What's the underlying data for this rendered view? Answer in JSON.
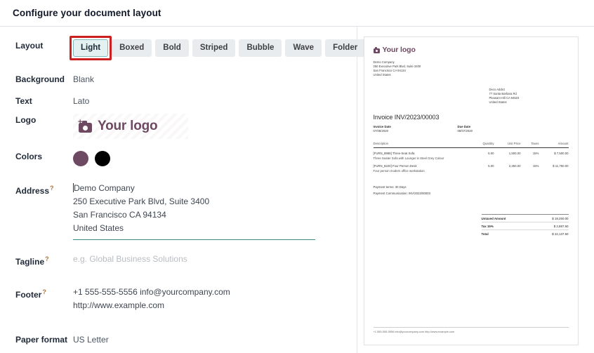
{
  "dialog": {
    "title": "Configure your document layout"
  },
  "form": {
    "layout": {
      "label": "Layout",
      "options": [
        "Light",
        "Boxed",
        "Bold",
        "Striped",
        "Bubble",
        "Wave",
        "Folder"
      ],
      "selected": "Light",
      "highlight_color": "#cc1f1f"
    },
    "background": {
      "label": "Background",
      "value": "Blank"
    },
    "text": {
      "label": "Text",
      "value": "Lato"
    },
    "logo": {
      "label": "Logo",
      "value": "Your logo",
      "icon": "camera-icon",
      "color": "#6d4a62"
    },
    "colors": {
      "label": "Colors",
      "swatches": [
        "#6d4a62",
        "#000000"
      ]
    },
    "address": {
      "label": "Address",
      "help": "?",
      "lines": [
        "Demo Company",
        "250 Executive Park Blvd, Suite 3400",
        "San Francisco CA 94134",
        "United States"
      ],
      "underline_color": "#3b8a8a"
    },
    "tagline": {
      "label": "Tagline",
      "help": "?",
      "placeholder": "e.g. Global Business Solutions",
      "value": ""
    },
    "footer": {
      "label": "Footer",
      "help": "?",
      "lines": [
        "+1 555-555-5556 info@yourcompany.com",
        "http://www.example.com"
      ]
    },
    "paper_format": {
      "label": "Paper format",
      "value": "US Letter"
    }
  },
  "preview": {
    "logo_text": "Your logo",
    "company_address": [
      "Demo Company",
      "250 Executive Park Blvd, Suite 3400",
      "San Francisco CA 94134",
      "United States"
    ],
    "customer_address": [
      "Deco Addict",
      "77 Santa Barbara Rd",
      "Pleasant Hill CA 94523",
      "United States"
    ],
    "doc_title": "Invoice INV/2023/00003",
    "invoice_date_label": "Invoice Date",
    "invoice_date_value": "07/08/2020",
    "due_date_label": "Due Date",
    "due_date_value": "08/07/2020",
    "table": {
      "headers": [
        "Description",
        "Quantity",
        "Unit Price",
        "Taxes",
        "Amount"
      ],
      "rows": [
        {
          "description": "[FURN_8999] Three-Seat Sofa",
          "sub": "Three Seater Sofa with Lounger in Steel Grey Colour",
          "quantity": "5.00",
          "unit_price": "1,500.00",
          "taxes": "15%",
          "amount": "$ 7,500.00"
        },
        {
          "description": "[FURN_8220] Four Person Desk",
          "sub": "Four person modern office workstation",
          "quantity": "5.00",
          "unit_price": "2,350.00",
          "taxes": "15%",
          "amount": "$ 11,750.00"
        }
      ]
    },
    "payment_terms": "Payment terms: 30 Days",
    "payment_communication": "Payment Communication: INV/2023/00003",
    "totals": [
      {
        "label": "Untaxed Amount",
        "value": "$ 19,250.00"
      },
      {
        "label": "Tax 15%",
        "value": "$ 2,887.50"
      },
      {
        "label": "Total",
        "value": "$ 22,137.50"
      }
    ],
    "footer_text": "+1 555-555-5556 info@yourcompany.com http://www.example.com"
  }
}
